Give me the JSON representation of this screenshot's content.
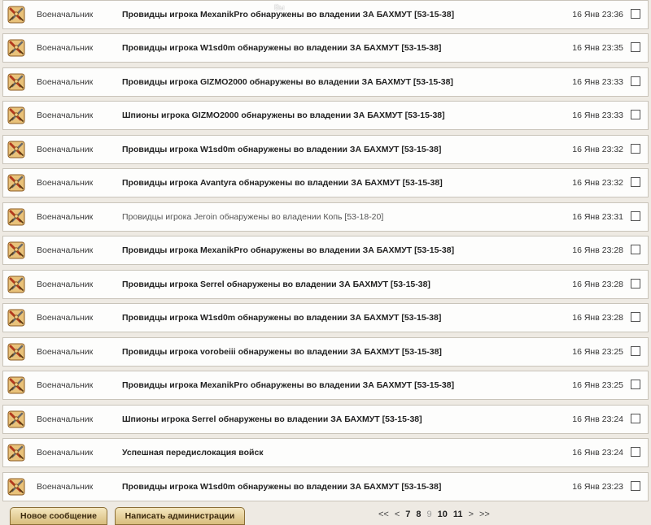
{
  "messages": [
    {
      "sender": "Военачальник",
      "subject": "Провидцы игрока MexanikPro обнаружены во владении ЗА БАХМУТ [53-15-38]",
      "date": "16 Янв 23:36",
      "unread": true
    },
    {
      "sender": "Военачальник",
      "subject": "Провидцы игрока W1sd0m обнаружены во владении ЗА БАХМУТ [53-15-38]",
      "date": "16 Янв 23:35",
      "unread": true
    },
    {
      "sender": "Военачальник",
      "subject": "Провидцы игрока GIZMO2000 обнаружены во владении ЗА БАХМУТ [53-15-38]",
      "date": "16 Янв 23:33",
      "unread": true
    },
    {
      "sender": "Военачальник",
      "subject": "Шпионы игрока GIZMO2000 обнаружены во владении ЗА БАХМУТ [53-15-38]",
      "date": "16 Янв 23:33",
      "unread": true
    },
    {
      "sender": "Военачальник",
      "subject": "Провидцы игрока W1sd0m обнаружены во владении ЗА БАХМУТ [53-15-38]",
      "date": "16 Янв 23:32",
      "unread": true
    },
    {
      "sender": "Военачальник",
      "subject": "Провидцы игрока Avantyra обнаружены во владении ЗА БАХМУТ [53-15-38]",
      "date": "16 Янв 23:32",
      "unread": true
    },
    {
      "sender": "Военачальник",
      "subject": "Провидцы игрока Jeroin обнаружены во владении Копь [53-18-20]",
      "date": "16 Янв 23:31",
      "unread": false
    },
    {
      "sender": "Военачальник",
      "subject": "Провидцы игрока MexanikPro обнаружены во владении ЗА БАХМУТ [53-15-38]",
      "date": "16 Янв 23:28",
      "unread": true
    },
    {
      "sender": "Военачальник",
      "subject": "Провидцы игрока Serrel обнаружены во владении ЗА БАХМУТ [53-15-38]",
      "date": "16 Янв 23:28",
      "unread": true
    },
    {
      "sender": "Военачальник",
      "subject": "Провидцы игрока W1sd0m обнаружены во владении ЗА БАХМУТ [53-15-38]",
      "date": "16 Янв 23:28",
      "unread": true
    },
    {
      "sender": "Военачальник",
      "subject": "Провидцы игрока vorobeiii обнаружены во владении ЗА БАХМУТ [53-15-38]",
      "date": "16 Янв 23:25",
      "unread": true
    },
    {
      "sender": "Военачальник",
      "subject": "Провидцы игрока MexanikPro обнаружены во владении ЗА БАХМУТ [53-15-38]",
      "date": "16 Янв 23:25",
      "unread": true
    },
    {
      "sender": "Военачальник",
      "subject": "Шпионы игрока Serrel обнаружены во владении ЗА БАХМУТ [53-15-38]",
      "date": "16 Янв 23:24",
      "unread": true
    },
    {
      "sender": "Военачальник",
      "subject": "Успешная передислокация войск",
      "date": "16 Янв 23:24",
      "unread": true
    },
    {
      "sender": "Военачальник",
      "subject": "Провидцы игрока W1sd0m обнаружены во владении ЗА БАХМУТ [53-15-38]",
      "date": "16 Янв 23:23",
      "unread": true
    }
  ],
  "icon": "crossed-swords-icon",
  "colors": {
    "button_top": "#f5e7bf",
    "button_bottom": "#d8bd7d",
    "row_border": "#c9c4ba",
    "background": "#eeeae3"
  },
  "toolbar": {
    "new_message_label": "Новое сообщение",
    "write_admin_label": "Написать администрации"
  },
  "pager": {
    "first": "<<",
    "prev": "<",
    "pages": [
      "7",
      "8",
      "9",
      "10",
      "11"
    ],
    "current": "9",
    "next": ">",
    "last": ">>"
  },
  "overlay_text": "Вы"
}
